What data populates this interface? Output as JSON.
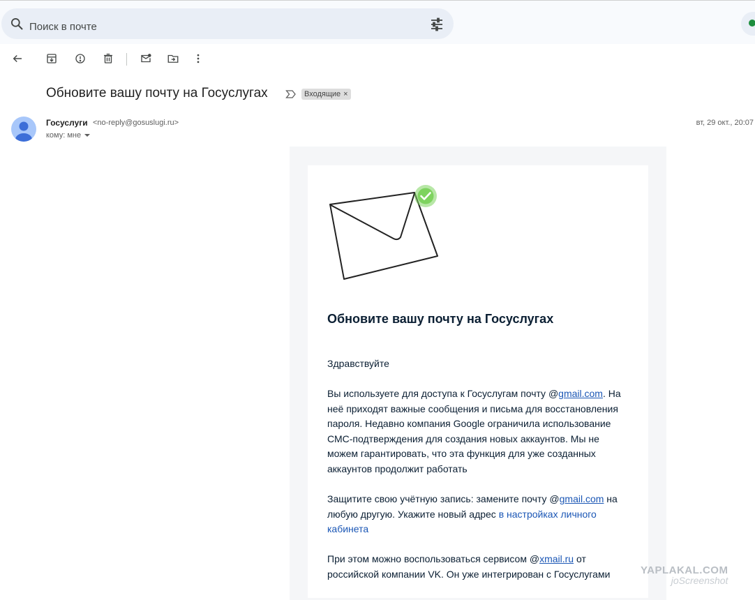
{
  "search": {
    "placeholder": "Поиск в почте"
  },
  "email": {
    "subject": "Обновите вашу почту на Госуслугах",
    "label": "Входящие",
    "label_close": "×",
    "sender_name": "Госуслуги",
    "sender_email": "<no-reply@gosuslugi.ru>",
    "to": "кому: мне",
    "date": "вт, 29 окт., 20:07"
  },
  "body": {
    "heading": "Обновите вашу почту на Госуслугах",
    "greeting": "Здравствуйте",
    "p2": {
      "t1": "Вы используете для доступа к Госуслугам почту @",
      "link1": "gmail.com",
      "t2": ". На неё приходят важные сообщения и письма для восстановления пароля. Недавно компания Google ограничила использование СМС-подтверждения для создания новых аккаунтов. Мы не можем гарантировать, что эта функция для уже созданных аккаунтов продолжит работать"
    },
    "p3": {
      "t1": "Защитите свою учётную запись: замените почту @",
      "link1": "gmail.com",
      "t2": " на любую другую. Укажите новый адрес ",
      "link2": "в настройках личного кабинета"
    },
    "p4": {
      "t1": "При этом можно воспользоваться сервисом @",
      "link1": "xmail.ru",
      "t2": " от российской компании VK. Он уже интегрирован с Госуслугами"
    }
  },
  "watermark": {
    "line1": "YAPLAKAL.COM",
    "line2": "joScreenshot"
  },
  "colors": {
    "accent": "#1a56b5",
    "status": "#1e8e3e",
    "check": "#7ed35f"
  },
  "icons": [
    "search-icon",
    "filter-icon",
    "back-arrow-icon",
    "archive-icon",
    "report-spam-icon",
    "delete-icon",
    "mark-unread-icon",
    "move-to-icon",
    "more-vert-icon",
    "importance-marker-icon",
    "avatar-person-icon",
    "checkmark-icon",
    "envelope-icon"
  ]
}
